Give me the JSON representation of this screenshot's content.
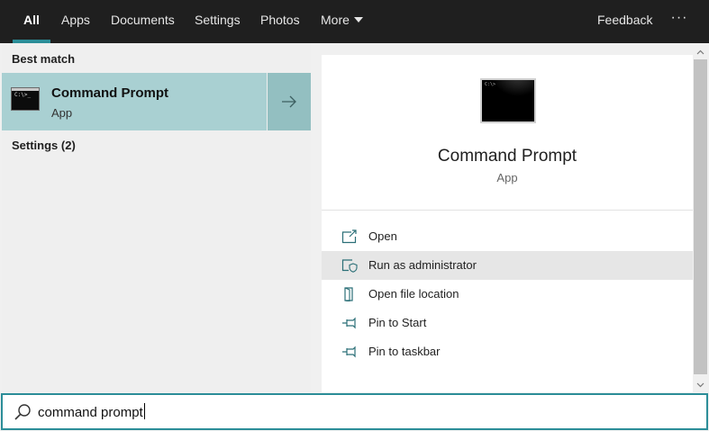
{
  "tabs": [
    {
      "label": "All",
      "active": true
    },
    {
      "label": "Apps"
    },
    {
      "label": "Documents"
    },
    {
      "label": "Settings"
    },
    {
      "label": "Photos"
    },
    {
      "label": "More"
    }
  ],
  "header": {
    "feedback_label": "Feedback",
    "more_options_label": "···"
  },
  "results": {
    "best_match_heading": "Best match",
    "best_match": {
      "title": "Command Prompt",
      "subtitle": "App",
      "icon": "command-prompt-icon"
    },
    "settings_heading": "Settings (2)"
  },
  "preview": {
    "title": "Command Prompt",
    "subtitle": "App",
    "actions": [
      {
        "label": "Open",
        "icon": "open-icon"
      },
      {
        "label": "Run as administrator",
        "icon": "shield-icon",
        "highlighted": true
      },
      {
        "label": "Open file location",
        "icon": "file-location-icon"
      },
      {
        "label": "Pin to Start",
        "icon": "pin-icon"
      },
      {
        "label": "Pin to taskbar",
        "icon": "pin-icon"
      }
    ]
  },
  "search": {
    "value": "command prompt",
    "icon": "search-icon"
  },
  "colors": {
    "accent": "#2b8d98",
    "selected_row": "#a9d0d2",
    "topbar": "#1f1f1f"
  }
}
